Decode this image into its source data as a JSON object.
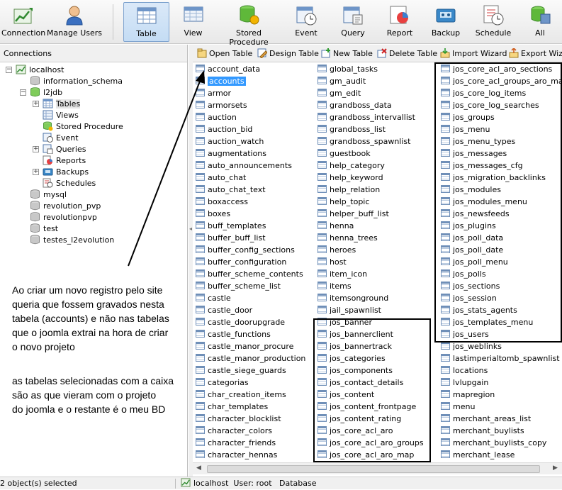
{
  "toolbar": {
    "buttons": [
      {
        "label": "Connection",
        "icon": "connection-icon"
      },
      {
        "label": "Manage Users",
        "icon": "user-icon"
      },
      {
        "label": "Table",
        "icon": "table-icon",
        "active": true
      },
      {
        "label": "View",
        "icon": "view-icon"
      },
      {
        "label": "Stored Procedure",
        "icon": "stored-procedure-icon"
      },
      {
        "label": "Event",
        "icon": "event-icon"
      },
      {
        "label": "Query",
        "icon": "query-icon"
      },
      {
        "label": "Report",
        "icon": "report-icon"
      },
      {
        "label": "Backup",
        "icon": "backup-icon"
      },
      {
        "label": "Schedule",
        "icon": "schedule-icon"
      },
      {
        "label": "All",
        "icon": "all-icon"
      }
    ]
  },
  "left_panel": {
    "header": "Connections",
    "tree": [
      {
        "label": "localhost",
        "icon": "server-icon",
        "expander": "-"
      },
      {
        "label": "information_schema",
        "icon": "database-icon"
      },
      {
        "label": "l2jdb",
        "icon": "database-open-icon",
        "expander": "-"
      },
      {
        "label": "Tables",
        "icon": "tables-icon",
        "expander": "+",
        "selected": true
      },
      {
        "label": "Views",
        "icon": "views-icon"
      },
      {
        "label": "Stored Procedure",
        "icon": "stored-procedure-icon"
      },
      {
        "label": "Event",
        "icon": "event-icon"
      },
      {
        "label": "Queries",
        "icon": "queries-icon",
        "expander": "+"
      },
      {
        "label": "Reports",
        "icon": "reports-icon"
      },
      {
        "label": "Backups",
        "icon": "backups-icon",
        "expander": "+"
      },
      {
        "label": "Schedules",
        "icon": "schedules-icon"
      },
      {
        "label": "mysql",
        "icon": "database-icon"
      },
      {
        "label": "revolution_pvp",
        "icon": "database-icon"
      },
      {
        "label": "revolutionpvp",
        "icon": "database-icon"
      },
      {
        "label": "test",
        "icon": "database-icon"
      },
      {
        "label": "testes_l2evolution",
        "icon": "database-icon"
      }
    ]
  },
  "object_toolbar": {
    "open": "Open Table",
    "design": "Design Table",
    "new": "New Table",
    "delete": "Delete Table",
    "import": "Import Wizard",
    "export": "Export Wiza"
  },
  "tables": {
    "col1": [
      "account_data",
      "accounts",
      "armor",
      "armorsets",
      "auction",
      "auction_bid",
      "auction_watch",
      "augmentations",
      "auto_announcements",
      "auto_chat",
      "auto_chat_text",
      "boxaccess",
      "boxes",
      "buff_templates",
      "buffer_buff_list",
      "buffer_config_sections",
      "buffer_configuration",
      "buffer_scheme_contents",
      "buffer_scheme_list",
      "castle",
      "castle_door",
      "castle_doorupgrade",
      "castle_functions",
      "castle_manor_procure",
      "castle_manor_production",
      "castle_siege_guards",
      "categorias",
      "char_creation_items",
      "char_templates",
      "character_blocklist",
      "character_colors",
      "character_friends",
      "character_hennas"
    ],
    "col2": [
      "global_tasks",
      "gm_audit",
      "gm_edit",
      "grandboss_data",
      "grandboss_intervallist",
      "grandboss_list",
      "grandboss_spawnlist",
      "guestbook",
      "help_category",
      "help_keyword",
      "help_relation",
      "help_topic",
      "helper_buff_list",
      "henna",
      "henna_trees",
      "heroes",
      "host",
      "item_icon",
      "items",
      "itemsonground",
      "jail_spawnlist",
      "jos_banner",
      "jos_bannerclient",
      "jos_bannertrack",
      "jos_categories",
      "jos_components",
      "jos_contact_details",
      "jos_content",
      "jos_content_frontpage",
      "jos_content_rating",
      "jos_core_acl_aro",
      "jos_core_acl_aro_groups",
      "jos_core_acl_aro_map"
    ],
    "col3": [
      "jos_core_acl_aro_sections",
      "jos_core_acl_groups_aro_map",
      "jos_core_log_items",
      "jos_core_log_searches",
      "jos_groups",
      "jos_menu",
      "jos_menu_types",
      "jos_messages",
      "jos_messages_cfg",
      "jos_migration_backlinks",
      "jos_modules",
      "jos_modules_menu",
      "jos_newsfeeds",
      "jos_plugins",
      "jos_poll_data",
      "jos_poll_date",
      "jos_poll_menu",
      "jos_polls",
      "jos_sections",
      "jos_session",
      "jos_stats_agents",
      "jos_templates_menu",
      "jos_users",
      "jos_weblinks",
      "lastimperialtomb_spawnlist",
      "locations",
      "lvlupgain",
      "mapregion",
      "menu",
      "merchant_areas_list",
      "merchant_buylists",
      "merchant_buylists_copy",
      "merchant_lease"
    ],
    "selected": "accounts"
  },
  "annotations": {
    "lines1": [
      "Ao criar um novo registro pelo site",
      "queria que fossem gravados nesta",
      "tabela (accounts) e não nas tabelas",
      "que o joomla extrai na hora de criar",
      "o novo projeto"
    ],
    "lines2": [
      "as tabelas selecionadas com a caixa",
      "são as que vieram com o projeto",
      "do joomla e o restante é o meu BD"
    ]
  },
  "status": {
    "selection": "2 object(s) selected",
    "connection": "localhost",
    "user": "User: root",
    "database": "Database"
  }
}
